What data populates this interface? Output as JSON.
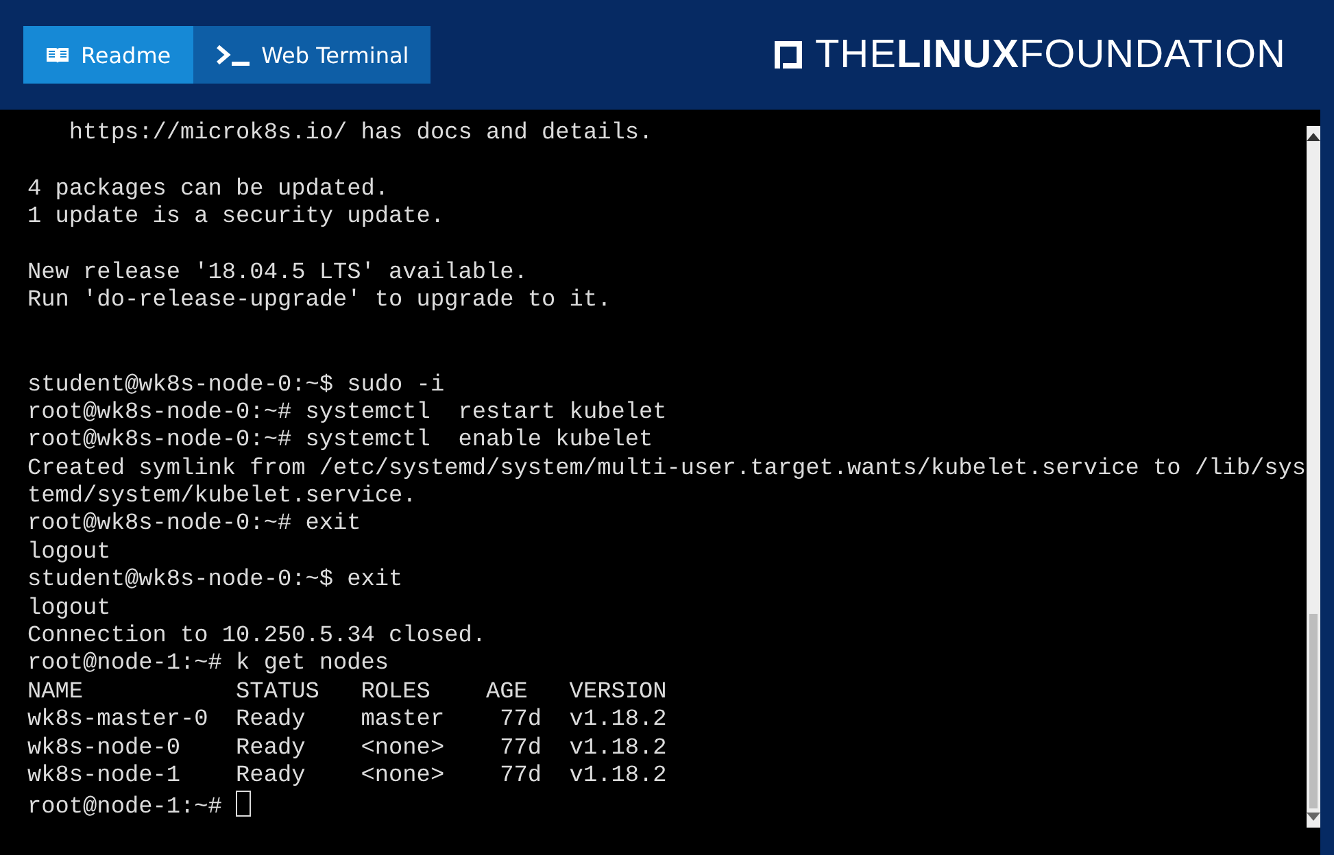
{
  "tabs": [
    {
      "label": "Readme",
      "kind": "book",
      "selected": true
    },
    {
      "label": "Web Terminal",
      "kind": "terminal",
      "selected": false
    }
  ],
  "logo": {
    "text": "THE**LINUX**FOUNDATION"
  },
  "terminal": {
    "blocks": [
      {
        "kind": "text",
        "lines": [
          "   https://microk8s.io/ has docs and details."
        ]
      },
      {
        "kind": "text",
        "lines": [
          "4 packages can be updated.",
          "1 update is a security update."
        ]
      },
      {
        "kind": "text",
        "lines": [
          "New release '18.04.5 LTS' available.",
          "Run 'do-release-upgrade' to upgrade to it."
        ]
      },
      {
        "kind": "session",
        "lines": [
          "student@wk8s-node-0:~$ sudo -i",
          "root@wk8s-node-0:~# systemctl  restart kubelet",
          "root@wk8s-node-0:~# systemctl  enable kubelet",
          "Created symlink from /etc/systemd/system/multi-user.target.wants/kubelet.service to /lib/sys",
          "temd/system/kubelet.service.",
          "root@wk8s-node-0:~# exit",
          "logout",
          "student@wk8s-node-0:~$ exit",
          "logout",
          "Connection to 10.250.5.34 closed.",
          "root@node-1:~# k get nodes",
          "NAME           STATUS   ROLES    AGE   VERSION",
          "wk8s-master-0  Ready    master    77d  v1.18.2",
          "wk8s-node-0    Ready    <none>    77d  v1.18.2",
          "wk8s-node-1    Ready    <none>    77d  v1.18.2"
        ]
      }
    ],
    "prompt": "root@node-1:~# "
  }
}
